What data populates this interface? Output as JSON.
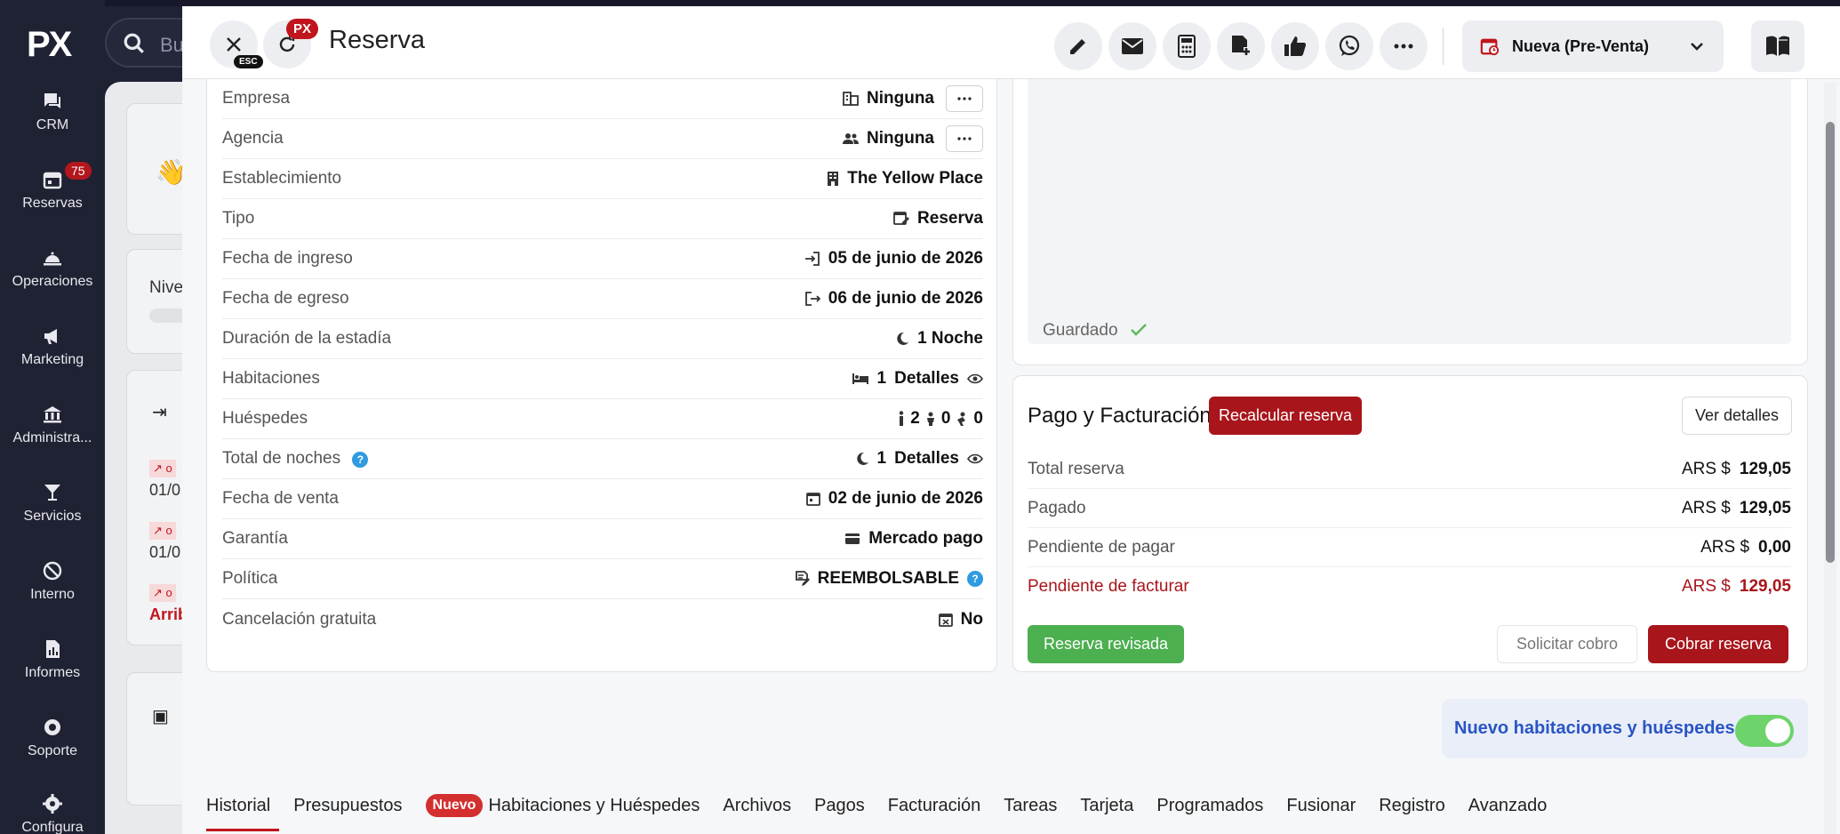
{
  "sidebar": {
    "logo": "PX",
    "items": [
      {
        "label": "CRM",
        "icon": "chat-icon"
      },
      {
        "label": "Reservas",
        "icon": "calendar-icon",
        "badge": "75"
      },
      {
        "label": "Operaciones",
        "icon": "bell-icon"
      },
      {
        "label": "Marketing",
        "icon": "megaphone-icon"
      },
      {
        "label": "Administra...",
        "icon": "bank-icon"
      },
      {
        "label": "Servicios",
        "icon": "cocktail-icon"
      },
      {
        "label": "Interno",
        "icon": "block-icon"
      },
      {
        "label": "Informes",
        "icon": "report-icon"
      },
      {
        "label": "Soporte",
        "icon": "support-icon"
      },
      {
        "label": "Configura",
        "icon": "gear-icon"
      }
    ]
  },
  "background": {
    "search_placeholder": "Bu",
    "level_text": "Nive",
    "item_dates": [
      "01/0",
      "01/0"
    ],
    "arrival_text": "Arrib"
  },
  "modal": {
    "title": "Reserva",
    "esc_label": "ESC",
    "px_badge": "PX",
    "state_select": "Nueva (Pre-Venta)",
    "toolbar_icons": [
      "pencil-icon",
      "mail-icon",
      "calculator-icon",
      "add-document-icon",
      "thumbs-up-icon",
      "whatsapp-icon",
      "more-icon"
    ]
  },
  "details": {
    "rows": [
      {
        "label": "Empresa",
        "value": "Ninguna",
        "icon": "company-icon",
        "has_menu": true
      },
      {
        "label": "Agencia",
        "value": "Ninguna",
        "icon": "people-icon",
        "has_menu": true
      },
      {
        "label": "Establecimiento",
        "value": "The Yellow Place",
        "icon": "building-icon"
      },
      {
        "label": "Tipo",
        "value": "Reserva",
        "icon": "calendar-edit-icon"
      },
      {
        "label": "Fecha de ingreso",
        "value": "05 de junio de 2026",
        "icon": "login-icon"
      },
      {
        "label": "Fecha de egreso",
        "value": "06 de junio de 2026",
        "icon": "logout-icon"
      },
      {
        "label": "Duración de la estadía",
        "value": "1 Noche",
        "icon": "moon-icon"
      },
      {
        "label": "Habitaciones",
        "value": "1",
        "detail": "Detalles",
        "icon": "bed-icon"
      },
      {
        "label": "Huéspedes",
        "adults": "2",
        "children": "0",
        "infants": "0"
      },
      {
        "label": "Total de noches",
        "value": "1",
        "detail": "Detalles",
        "icon": "moon-icon",
        "help": "?"
      },
      {
        "label": "Fecha de venta",
        "value": "02 de junio de 2026",
        "icon": "calendar-icon"
      },
      {
        "label": "Garantía",
        "value": "Mercado pago",
        "icon": "card-icon"
      },
      {
        "label": "Política",
        "value": "REEMBOLSABLE",
        "icon": "policy-icon",
        "help": "?"
      },
      {
        "label": "Cancelación gratuita",
        "value": "No",
        "icon": "calendar-x-icon"
      }
    ]
  },
  "notes": {
    "saved_label": "Guardado"
  },
  "billing": {
    "title": "Pago y Facturación",
    "recalc_button": "Recalcular reserva",
    "details_button": "Ver detalles",
    "rows": [
      {
        "label": "Total reserva",
        "currency": "ARS $",
        "amount": "129,05"
      },
      {
        "label": "Pagado",
        "currency": "ARS $",
        "amount": "129,05"
      },
      {
        "label": "Pendiente de pagar",
        "currency": "ARS $",
        "amount": "0,00"
      },
      {
        "label": "Pendiente de facturar",
        "currency": "ARS $",
        "amount": "129,05"
      }
    ],
    "reviewed_button": "Reserva revisada",
    "request_button": "Solicitar cobro",
    "charge_button": "Cobrar reserva"
  },
  "toggle": {
    "label": "Nuevo habitaciones y huéspedes",
    "on": true
  },
  "tabs": {
    "new_badge": "Nuevo",
    "items": [
      "Historial",
      "Presupuestos",
      "Habitaciones y Huéspedes",
      "Archivos",
      "Pagos",
      "Facturación",
      "Tareas",
      "Tarjeta",
      "Programados",
      "Fusionar",
      "Registro",
      "Avanzado"
    ],
    "active": "Historial"
  },
  "colors": {
    "sidebar": "#1f2233",
    "accent_red": "#a8151b",
    "green": "#4caf50",
    "toggle_text": "#2a55c4"
  }
}
